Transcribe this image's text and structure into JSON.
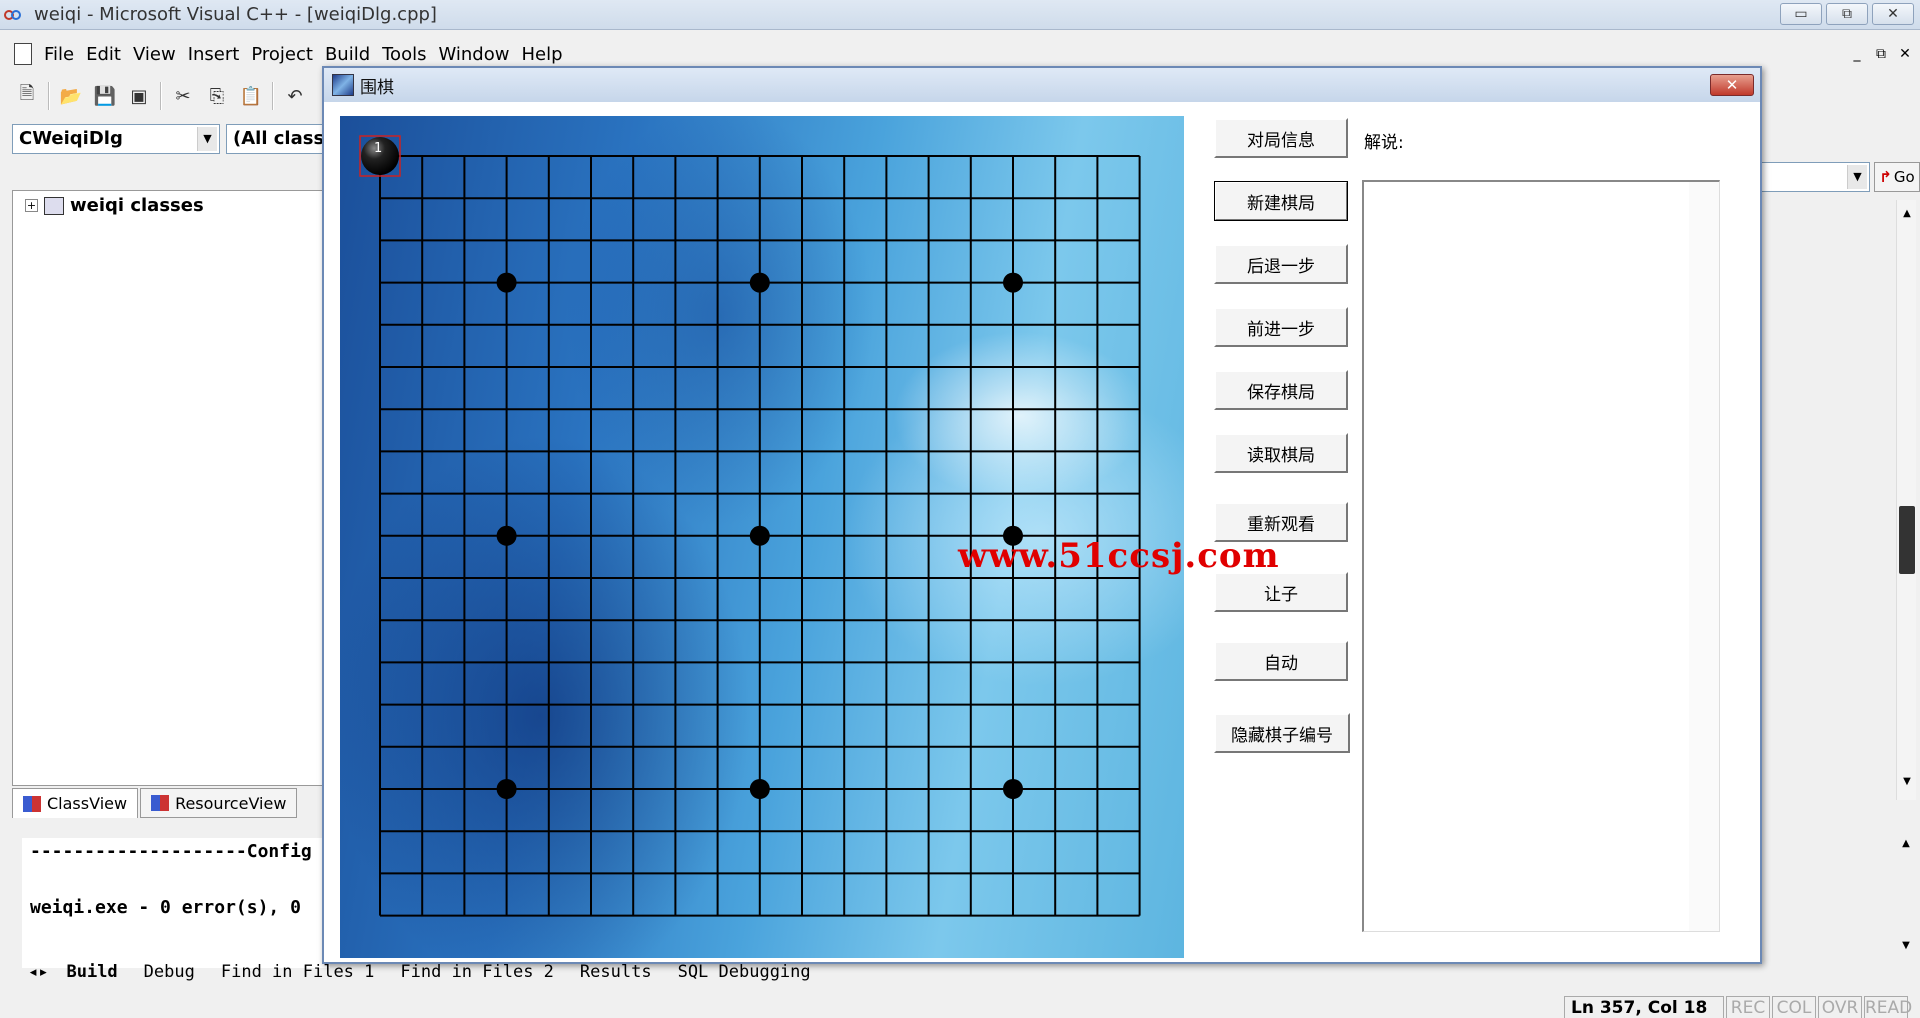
{
  "ide": {
    "title": "weiqi - Microsoft Visual C++ - [weiqiDlg.cpp]",
    "window_controls": [
      "▭",
      "⧉",
      "✕"
    ],
    "mdi_controls": [
      "_",
      "⧉",
      "✕"
    ],
    "menu": [
      "File",
      "Edit",
      "View",
      "Insert",
      "Project",
      "Build",
      "Tools",
      "Window",
      "Help"
    ],
    "class_combo": "CWeiqiDlg",
    "member_combo": "(All class m",
    "tree_root": "weiqi classes",
    "tabs": [
      "ClassView",
      "ResourceView"
    ],
    "output_lines": [
      "--------------------Config",
      "",
      "weiqi.exe - 0 error(s), 0"
    ],
    "bottom_tabs": [
      "Build",
      "Debug",
      "Find in Files 1",
      "Find in Files 2",
      "Results",
      "SQL Debugging"
    ],
    "status": {
      "position": "Ln 357, Col 18",
      "flags": [
        "REC",
        "COL",
        "OVR",
        "READ"
      ]
    },
    "go_label": "Go"
  },
  "dialog": {
    "title": "围棋",
    "close": "✕",
    "buttons": [
      "对局信息",
      "新建棋局",
      "后退一步",
      "前进一步",
      "保存棋局",
      "读取棋局",
      "重新观看",
      "让子",
      "自动",
      "隐藏棋子编号"
    ],
    "commentary_label": "解说:",
    "watermark": "www.51ccsj.com"
  },
  "board": {
    "size": 19,
    "star_points": [
      [
        3,
        3
      ],
      [
        9,
        3
      ],
      [
        15,
        3
      ],
      [
        3,
        9
      ],
      [
        9,
        9
      ],
      [
        15,
        9
      ],
      [
        3,
        15
      ],
      [
        9,
        15
      ],
      [
        15,
        15
      ]
    ],
    "stones": [
      {
        "col": 0,
        "row": 0,
        "color": "black",
        "number": "1"
      }
    ],
    "line_color": "#000000"
  }
}
